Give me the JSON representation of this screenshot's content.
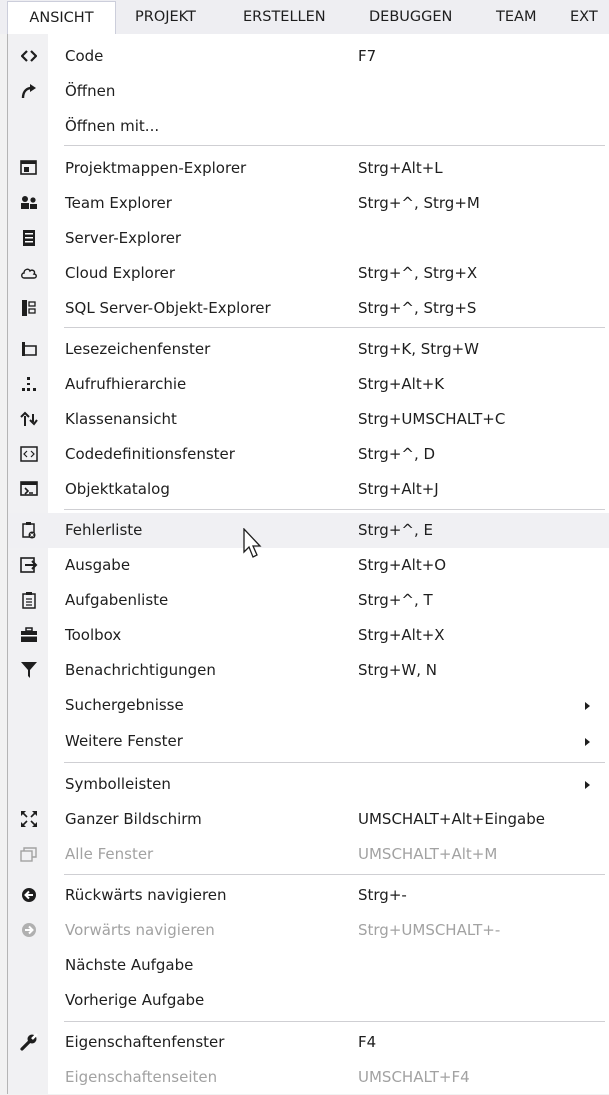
{
  "menubar": {
    "tabs": [
      "ANSICHT",
      "PROJEKT",
      "ERSTELLEN",
      "DEBUGGEN",
      "TEAM",
      "EXT"
    ]
  },
  "menu": {
    "items": [
      {
        "label": "Code",
        "shortcut": "F7",
        "icon": "code-icon"
      },
      {
        "label": "Öffnen",
        "shortcut": "",
        "icon": "redo-arrow-icon"
      },
      {
        "label": "Öffnen mit...",
        "shortcut": "",
        "icon": ""
      },
      {
        "label": "Projektmappen-Explorer",
        "shortcut": "Strg+Alt+L",
        "icon": "solution-explorer-icon"
      },
      {
        "label": "Team Explorer",
        "shortcut": "Strg+^, Strg+M",
        "icon": "team-icon"
      },
      {
        "label": "Server-Explorer",
        "shortcut": "",
        "icon": "server-icon"
      },
      {
        "label": "Cloud Explorer",
        "shortcut": "Strg+^, Strg+X",
        "icon": "cloud-icon"
      },
      {
        "label": "SQL Server-Objekt-Explorer",
        "shortcut": "Strg+^, Strg+S",
        "icon": "sql-server-icon"
      },
      {
        "label": "Lesezeichenfenster",
        "shortcut": "Strg+K, Strg+W",
        "icon": "bookmark-icon"
      },
      {
        "label": "Aufrufhierarchie",
        "shortcut": "Strg+Alt+K",
        "icon": "call-hierarchy-icon"
      },
      {
        "label": "Klassenansicht",
        "shortcut": "Strg+UMSCHALT+C",
        "icon": "class-view-icon"
      },
      {
        "label": "Codedefinitionsfenster",
        "shortcut": "Strg+^, D",
        "icon": "code-definition-icon"
      },
      {
        "label": "Objektkatalog",
        "shortcut": "Strg+Alt+J",
        "icon": "object-browser-icon"
      },
      {
        "label": "Fehlerliste",
        "shortcut": "Strg+^, E",
        "icon": "error-list-icon"
      },
      {
        "label": "Ausgabe",
        "shortcut": "Strg+Alt+O",
        "icon": "output-icon"
      },
      {
        "label": "Aufgabenliste",
        "shortcut": "Strg+^, T",
        "icon": "task-list-icon"
      },
      {
        "label": "Toolbox",
        "shortcut": "Strg+Alt+X",
        "icon": "toolbox-icon"
      },
      {
        "label": "Benachrichtigungen",
        "shortcut": "Strg+W, N",
        "icon": "notification-flag-icon"
      },
      {
        "label": "Suchergebnisse",
        "shortcut": "",
        "icon": ""
      },
      {
        "label": "Weitere Fenster",
        "shortcut": "",
        "icon": ""
      },
      {
        "label": "Symbolleisten",
        "shortcut": "",
        "icon": ""
      },
      {
        "label": "Ganzer Bildschirm",
        "shortcut": "UMSCHALT+Alt+Eingabe",
        "icon": "fullscreen-icon"
      },
      {
        "label": "Alle Fenster",
        "shortcut": "UMSCHALT+Alt+M",
        "icon": "all-windows-icon"
      },
      {
        "label": "Rückwärts navigieren",
        "shortcut": "Strg+-",
        "icon": "navigate-back-icon"
      },
      {
        "label": "Vorwärts navigieren",
        "shortcut": "Strg+UMSCHALT+-",
        "icon": "navigate-forward-icon"
      },
      {
        "label": "Nächste Aufgabe",
        "shortcut": "",
        "icon": ""
      },
      {
        "label": "Vorherige Aufgabe",
        "shortcut": "",
        "icon": ""
      },
      {
        "label": "Eigenschaftenfenster",
        "shortcut": "F4",
        "icon": "wrench-icon"
      },
      {
        "label": "Eigenschaftenseiten",
        "shortcut": "UMSCHALT+F4",
        "icon": ""
      }
    ]
  },
  "colors": {
    "text": "#1e1e1e",
    "disabled": "#a2a2a2",
    "hover": "#f0f0f3",
    "gutter": "#f1f1f3"
  }
}
